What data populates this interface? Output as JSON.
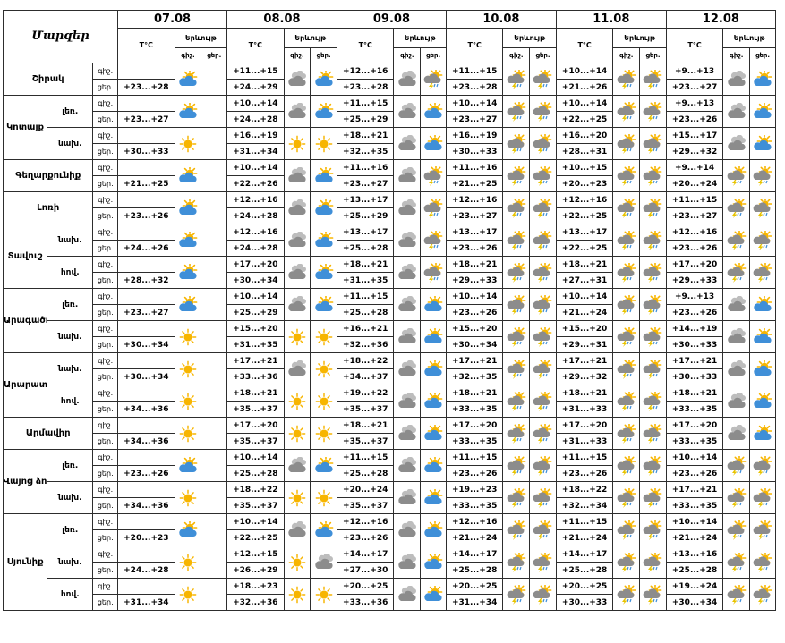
{
  "header": {
    "title": "Մարզեր",
    "temp_label": "T°C",
    "weather_label": "Երևույթ",
    "night_label": "գիշ.",
    "day_label": "ցեր."
  },
  "dates": [
    "07.08",
    "08.08",
    "09.08",
    "10.08",
    "11.08",
    "12.08"
  ],
  "regions": [
    {
      "name": "Շիրակ",
      "subs": [
        {
          "label": "",
          "first": [
            "+23...+28",
            "partly"
          ],
          "days": [
            [
              "+11...+15",
              "cloud",
              "+24...+29",
              "partly"
            ],
            [
              "+12...+16",
              "cloud",
              "+23...+28",
              "storm"
            ],
            [
              "+11...+15",
              "storm",
              "+23...+28",
              "storm"
            ],
            [
              "+10...+14",
              "storm",
              "+21...+26",
              "storm"
            ],
            [
              "+9...+13",
              "cloud",
              "+23...+27",
              "partly"
            ]
          ]
        }
      ]
    },
    {
      "name": "Կոտայք",
      "subs": [
        {
          "label": "լեռ.",
          "first": [
            "+23...+27",
            "partly"
          ],
          "days": [
            [
              "+10...+14",
              "cloud",
              "+24...+28",
              "partly"
            ],
            [
              "+11...+15",
              "cloud",
              "+25...+29",
              "partly"
            ],
            [
              "+10...+14",
              "storm",
              "+23...+27",
              "storm"
            ],
            [
              "+10...+14",
              "storm",
              "+22...+25",
              "storm"
            ],
            [
              "+9...+13",
              "cloud",
              "+23...+26",
              "partly"
            ]
          ]
        },
        {
          "label": "նախ.",
          "first": [
            "+30...+33",
            "sun"
          ],
          "days": [
            [
              "+16...+19",
              "sun",
              "+31...+34",
              "sun"
            ],
            [
              "+18...+21",
              "cloud",
              "+32...+35",
              "partly"
            ],
            [
              "+16...+19",
              "storm",
              "+30...+33",
              "storm"
            ],
            [
              "+16...+20",
              "storm",
              "+28...+31",
              "storm"
            ],
            [
              "+15...+17",
              "cloud",
              "+29...+32",
              "partly"
            ]
          ]
        }
      ]
    },
    {
      "name": "Գեղարքունիք",
      "subs": [
        {
          "label": "",
          "first": [
            "+21...+25",
            "partly"
          ],
          "days": [
            [
              "+10...+14",
              "cloud",
              "+22...+26",
              "partly"
            ],
            [
              "+11...+16",
              "cloud",
              "+23...+27",
              "storm"
            ],
            [
              "+11...+16",
              "storm",
              "+21...+25",
              "storm"
            ],
            [
              "+10...+15",
              "storm",
              "+20...+23",
              "storm"
            ],
            [
              "+9...+14",
              "storm",
              "+20...+24",
              "storm"
            ]
          ]
        }
      ]
    },
    {
      "name": "Լոռի",
      "subs": [
        {
          "label": "",
          "first": [
            "+23...+26",
            "partly"
          ],
          "days": [
            [
              "+12...+16",
              "cloud",
              "+24...+28",
              "partly"
            ],
            [
              "+13...+17",
              "cloud",
              "+25...+29",
              "storm"
            ],
            [
              "+12...+16",
              "storm",
              "+23...+27",
              "storm"
            ],
            [
              "+12...+16",
              "storm",
              "+22...+25",
              "storm"
            ],
            [
              "+11...+15",
              "storm",
              "+23...+27",
              "storm"
            ]
          ]
        }
      ]
    },
    {
      "name": "Տավուշ",
      "subs": [
        {
          "label": "նախ.",
          "first": [
            "+24...+26",
            "partly"
          ],
          "days": [
            [
              "+12...+16",
              "cloud",
              "+24...+28",
              "partly"
            ],
            [
              "+13...+17",
              "cloud",
              "+25...+28",
              "storm"
            ],
            [
              "+13...+17",
              "storm",
              "+23...+26",
              "storm"
            ],
            [
              "+13...+17",
              "storm",
              "+22...+25",
              "storm"
            ],
            [
              "+12...+16",
              "storm",
              "+23...+26",
              "storm"
            ]
          ]
        },
        {
          "label": "հով.",
          "first": [
            "+28...+32",
            "partly"
          ],
          "days": [
            [
              "+17...+20",
              "cloud",
              "+30...+34",
              "partly"
            ],
            [
              "+18...+21",
              "cloud",
              "+31...+35",
              "storm"
            ],
            [
              "+18...+21",
              "storm",
              "+29...+33",
              "storm"
            ],
            [
              "+18...+21",
              "storm",
              "+27...+31",
              "storm"
            ],
            [
              "+17...+20",
              "storm",
              "+29...+33",
              "storm"
            ]
          ]
        }
      ]
    },
    {
      "name": "Արագածոտն",
      "subs": [
        {
          "label": "լեռ.",
          "first": [
            "+23...+27",
            "partly"
          ],
          "days": [
            [
              "+10...+14",
              "cloud",
              "+25...+29",
              "partly"
            ],
            [
              "+11...+15",
              "cloud",
              "+25...+28",
              "partly"
            ],
            [
              "+10...+14",
              "storm",
              "+23...+26",
              "storm"
            ],
            [
              "+10...+14",
              "storm",
              "+21...+24",
              "storm"
            ],
            [
              "+9...+13",
              "cloud",
              "+23...+26",
              "partly"
            ]
          ]
        },
        {
          "label": "նախ.",
          "first": [
            "+30...+34",
            "sun"
          ],
          "days": [
            [
              "+15...+20",
              "sun",
              "+31...+35",
              "sun"
            ],
            [
              "+16...+21",
              "cloud",
              "+32...+36",
              "partly"
            ],
            [
              "+15...+20",
              "storm",
              "+30...+34",
              "storm"
            ],
            [
              "+15...+20",
              "storm",
              "+29...+31",
              "storm"
            ],
            [
              "+14...+19",
              "cloud",
              "+30...+33",
              "partly"
            ]
          ]
        }
      ]
    },
    {
      "name": "Արարատ",
      "subs": [
        {
          "label": "նախ.",
          "first": [
            "+30...+34",
            "sun"
          ],
          "days": [
            [
              "+17...+21",
              "cloud",
              "+33...+36",
              "sun"
            ],
            [
              "+18...+22",
              "cloud",
              "+34...+37",
              "partly"
            ],
            [
              "+17...+21",
              "storm",
              "+32...+35",
              "storm"
            ],
            [
              "+17...+21",
              "storm",
              "+29...+32",
              "storm"
            ],
            [
              "+17...+21",
              "cloud",
              "+30...+33",
              "partly"
            ]
          ]
        },
        {
          "label": "հով.",
          "first": [
            "+34...+36",
            "sun"
          ],
          "days": [
            [
              "+18...+21",
              "sun",
              "+35...+37",
              "sun"
            ],
            [
              "+19...+22",
              "cloud",
              "+35...+37",
              "partly"
            ],
            [
              "+18...+21",
              "storm",
              "+33...+35",
              "storm"
            ],
            [
              "+18...+21",
              "storm",
              "+31...+33",
              "storm"
            ],
            [
              "+18...+21",
              "cloud",
              "+33...+35",
              "partly"
            ]
          ]
        }
      ]
    },
    {
      "name": "Արմավիր",
      "subs": [
        {
          "label": "",
          "first": [
            "+34...+36",
            "sun"
          ],
          "days": [
            [
              "+17...+20",
              "sun",
              "+35...+37",
              "sun"
            ],
            [
              "+18...+21",
              "cloud",
              "+35...+37",
              "partly"
            ],
            [
              "+17...+20",
              "storm",
              "+33...+35",
              "storm"
            ],
            [
              "+17...+20",
              "storm",
              "+31...+33",
              "storm"
            ],
            [
              "+17...+20",
              "cloud",
              "+33...+35",
              "partly"
            ]
          ]
        }
      ]
    },
    {
      "name": "Վայոց ձոր",
      "subs": [
        {
          "label": "լեռ.",
          "first": [
            "+23...+26",
            "partly"
          ],
          "days": [
            [
              "+10...+14",
              "cloud",
              "+25...+28",
              "partly"
            ],
            [
              "+11...+15",
              "cloud",
              "+25...+28",
              "partly"
            ],
            [
              "+11...+15",
              "storm",
              "+23...+26",
              "storm"
            ],
            [
              "+11...+15",
              "storm",
              "+23...+26",
              "storm"
            ],
            [
              "+10...+14",
              "storm",
              "+23...+26",
              "storm"
            ]
          ]
        },
        {
          "label": "նախ.",
          "first": [
            "+34...+36",
            "sun"
          ],
          "days": [
            [
              "+18...+22",
              "sun",
              "+35...+37",
              "sun"
            ],
            [
              "+20...+24",
              "cloud",
              "+35...+37",
              "partly"
            ],
            [
              "+19...+23",
              "storm",
              "+33...+35",
              "storm"
            ],
            [
              "+18...+22",
              "storm",
              "+32...+34",
              "storm"
            ],
            [
              "+17...+21",
              "storm",
              "+33...+35",
              "storm"
            ]
          ]
        }
      ]
    },
    {
      "name": "Սյունիք",
      "subs": [
        {
          "label": "լեռ.",
          "first": [
            "+20...+23",
            "partly"
          ],
          "days": [
            [
              "+10...+14",
              "cloud",
              "+22...+25",
              "partly"
            ],
            [
              "+12...+16",
              "cloud",
              "+23...+26",
              "partly"
            ],
            [
              "+12...+16",
              "storm",
              "+21...+24",
              "storm"
            ],
            [
              "+11...+15",
              "storm",
              "+21...+24",
              "storm"
            ],
            [
              "+10...+14",
              "storm",
              "+21...+24",
              "storm"
            ]
          ]
        },
        {
          "label": "նախ.",
          "first": [
            "+24...+28",
            "sun"
          ],
          "days": [
            [
              "+12...+15",
              "sun",
              "+26...+29",
              "cloud"
            ],
            [
              "+14...+17",
              "cloud",
              "+27...+30",
              "partly"
            ],
            [
              "+14...+17",
              "storm",
              "+25...+28",
              "storm"
            ],
            [
              "+14...+17",
              "storm",
              "+25...+28",
              "storm"
            ],
            [
              "+13...+16",
              "storm",
              "+25...+28",
              "storm"
            ]
          ]
        },
        {
          "label": "հով.",
          "first": [
            "+31...+34",
            "sun"
          ],
          "days": [
            [
              "+18...+23",
              "sun",
              "+32...+36",
              "sun"
            ],
            [
              "+20...+25",
              "cloud",
              "+33...+36",
              "partly"
            ],
            [
              "+20...+25",
              "storm",
              "+31...+34",
              "storm"
            ],
            [
              "+20...+25",
              "storm",
              "+30...+33",
              "storm"
            ],
            [
              "+19...+24",
              "storm",
              "+30...+34",
              "storm"
            ]
          ]
        }
      ]
    }
  ],
  "icons": {
    "sun": "sun-icon",
    "partly": "partly-cloudy-icon",
    "cloud": "cloudy-icon",
    "storm": "thunderstorm-icon"
  },
  "colors": {
    "sun": "#f7b500",
    "cloud_gray": "#8c8c8c",
    "cloud_blue": "#3f8fd8",
    "bolt": "#e8c300"
  }
}
